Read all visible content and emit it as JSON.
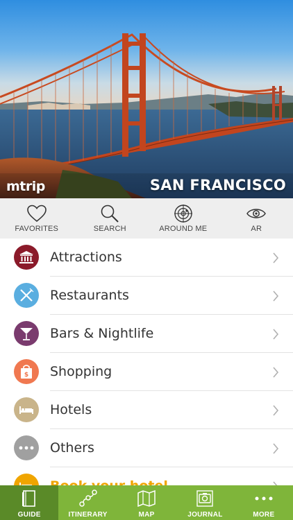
{
  "hero": {
    "brand": "mtrip",
    "city": "SAN FRANCISCO"
  },
  "quick_actions": [
    {
      "label": "FAVORITES",
      "icon": "heart-icon"
    },
    {
      "label": "SEARCH",
      "icon": "search-icon"
    },
    {
      "label": "AROUND ME",
      "icon": "radar-icon"
    },
    {
      "label": "AR",
      "icon": "eye-icon"
    }
  ],
  "categories": [
    {
      "label": "Attractions",
      "icon": "museum-icon",
      "color": "#8b1a2a"
    },
    {
      "label": "Restaurants",
      "icon": "fork-knife-icon",
      "color": "#5aaee0"
    },
    {
      "label": "Bars & Nightlife",
      "icon": "cocktail-icon",
      "color": "#7a3b6e"
    },
    {
      "label": "Shopping",
      "icon": "shopping-bag-icon",
      "color": "#f07850"
    },
    {
      "label": "Hotels",
      "icon": "bed-icon",
      "color": "#c9b48a"
    },
    {
      "label": "Others",
      "icon": "more-dots-icon",
      "color": "#a0a0a0"
    },
    {
      "label": "Book your hotel",
      "icon": "hotel-booking-icon",
      "color": "#f0a500"
    }
  ],
  "tabs": [
    {
      "label": "GUIDE",
      "icon": "book-icon",
      "active": true
    },
    {
      "label": "ITINERARY",
      "icon": "route-icon",
      "active": false
    },
    {
      "label": "MAP",
      "icon": "map-icon",
      "active": false
    },
    {
      "label": "JOURNAL",
      "icon": "camera-icon",
      "active": false
    },
    {
      "label": "MORE",
      "icon": "more-icon",
      "active": false
    }
  ],
  "colors": {
    "tabbar": "#7fb53a",
    "tabbar_active": "#5a8a28",
    "quickbar": "#eeeeee",
    "promo_text": "#f0a500"
  }
}
